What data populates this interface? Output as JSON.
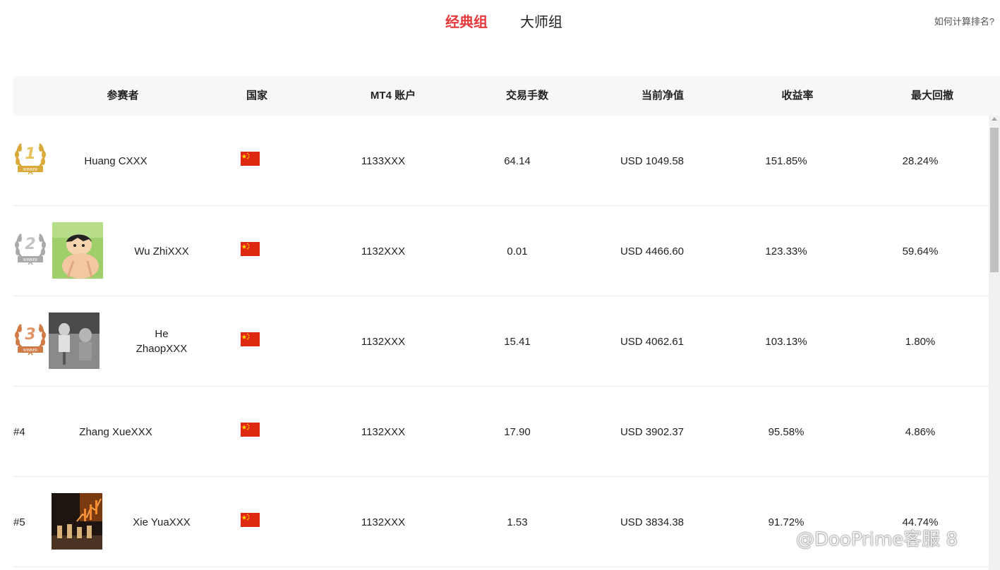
{
  "tabs": [
    {
      "label": "经典组",
      "active": true
    },
    {
      "label": "大师组",
      "active": false
    }
  ],
  "help_link": "如何计算排名?",
  "columns": [
    "参赛者",
    "国家",
    "MT4 账户",
    "交易手数",
    "当前净值",
    "收益率",
    "最大回撤"
  ],
  "rows": [
    {
      "rank": "1",
      "medal": "gold",
      "name": "Huang CXXX",
      "country": "china-flag",
      "account": "1133XXX",
      "lots": "64.14",
      "equity": "USD 1049.58",
      "return": "151.85%",
      "drawdown": "28.24%"
    },
    {
      "rank": "2",
      "medal": "silver",
      "name": "Wu ZhiXXX",
      "country": "china-flag",
      "account": "1132XXX",
      "lots": "0.01",
      "equity": "USD 4466.60",
      "return": "123.33%",
      "drawdown": "59.64%"
    },
    {
      "rank": "3",
      "medal": "bronze",
      "name_line1": "He",
      "name_line2": "ZhaopXXX",
      "country": "china-flag",
      "account": "1132XXX",
      "lots": "15.41",
      "equity": "USD 4062.61",
      "return": "103.13%",
      "drawdown": "1.80%"
    },
    {
      "rank": "#4",
      "name": "Zhang XueXXX",
      "country": "china-flag",
      "account": "1132XXX",
      "lots": "17.90",
      "equity": "USD 3902.37",
      "return": "95.58%",
      "drawdown": "4.86%"
    },
    {
      "rank": "#5",
      "name": "Xie YuaXXX",
      "country": "china-flag",
      "account": "1132XXX",
      "lots": "1.53",
      "equity": "USD 3834.38",
      "return": "91.72%",
      "drawdown": "44.74%"
    }
  ],
  "medal_colors": {
    "gold": "#d9a93a",
    "silver": "#a9a9a9",
    "bronze": "#d07a45"
  },
  "accent_color": "#e5393c",
  "watermark": "@DooPrime客服 8"
}
